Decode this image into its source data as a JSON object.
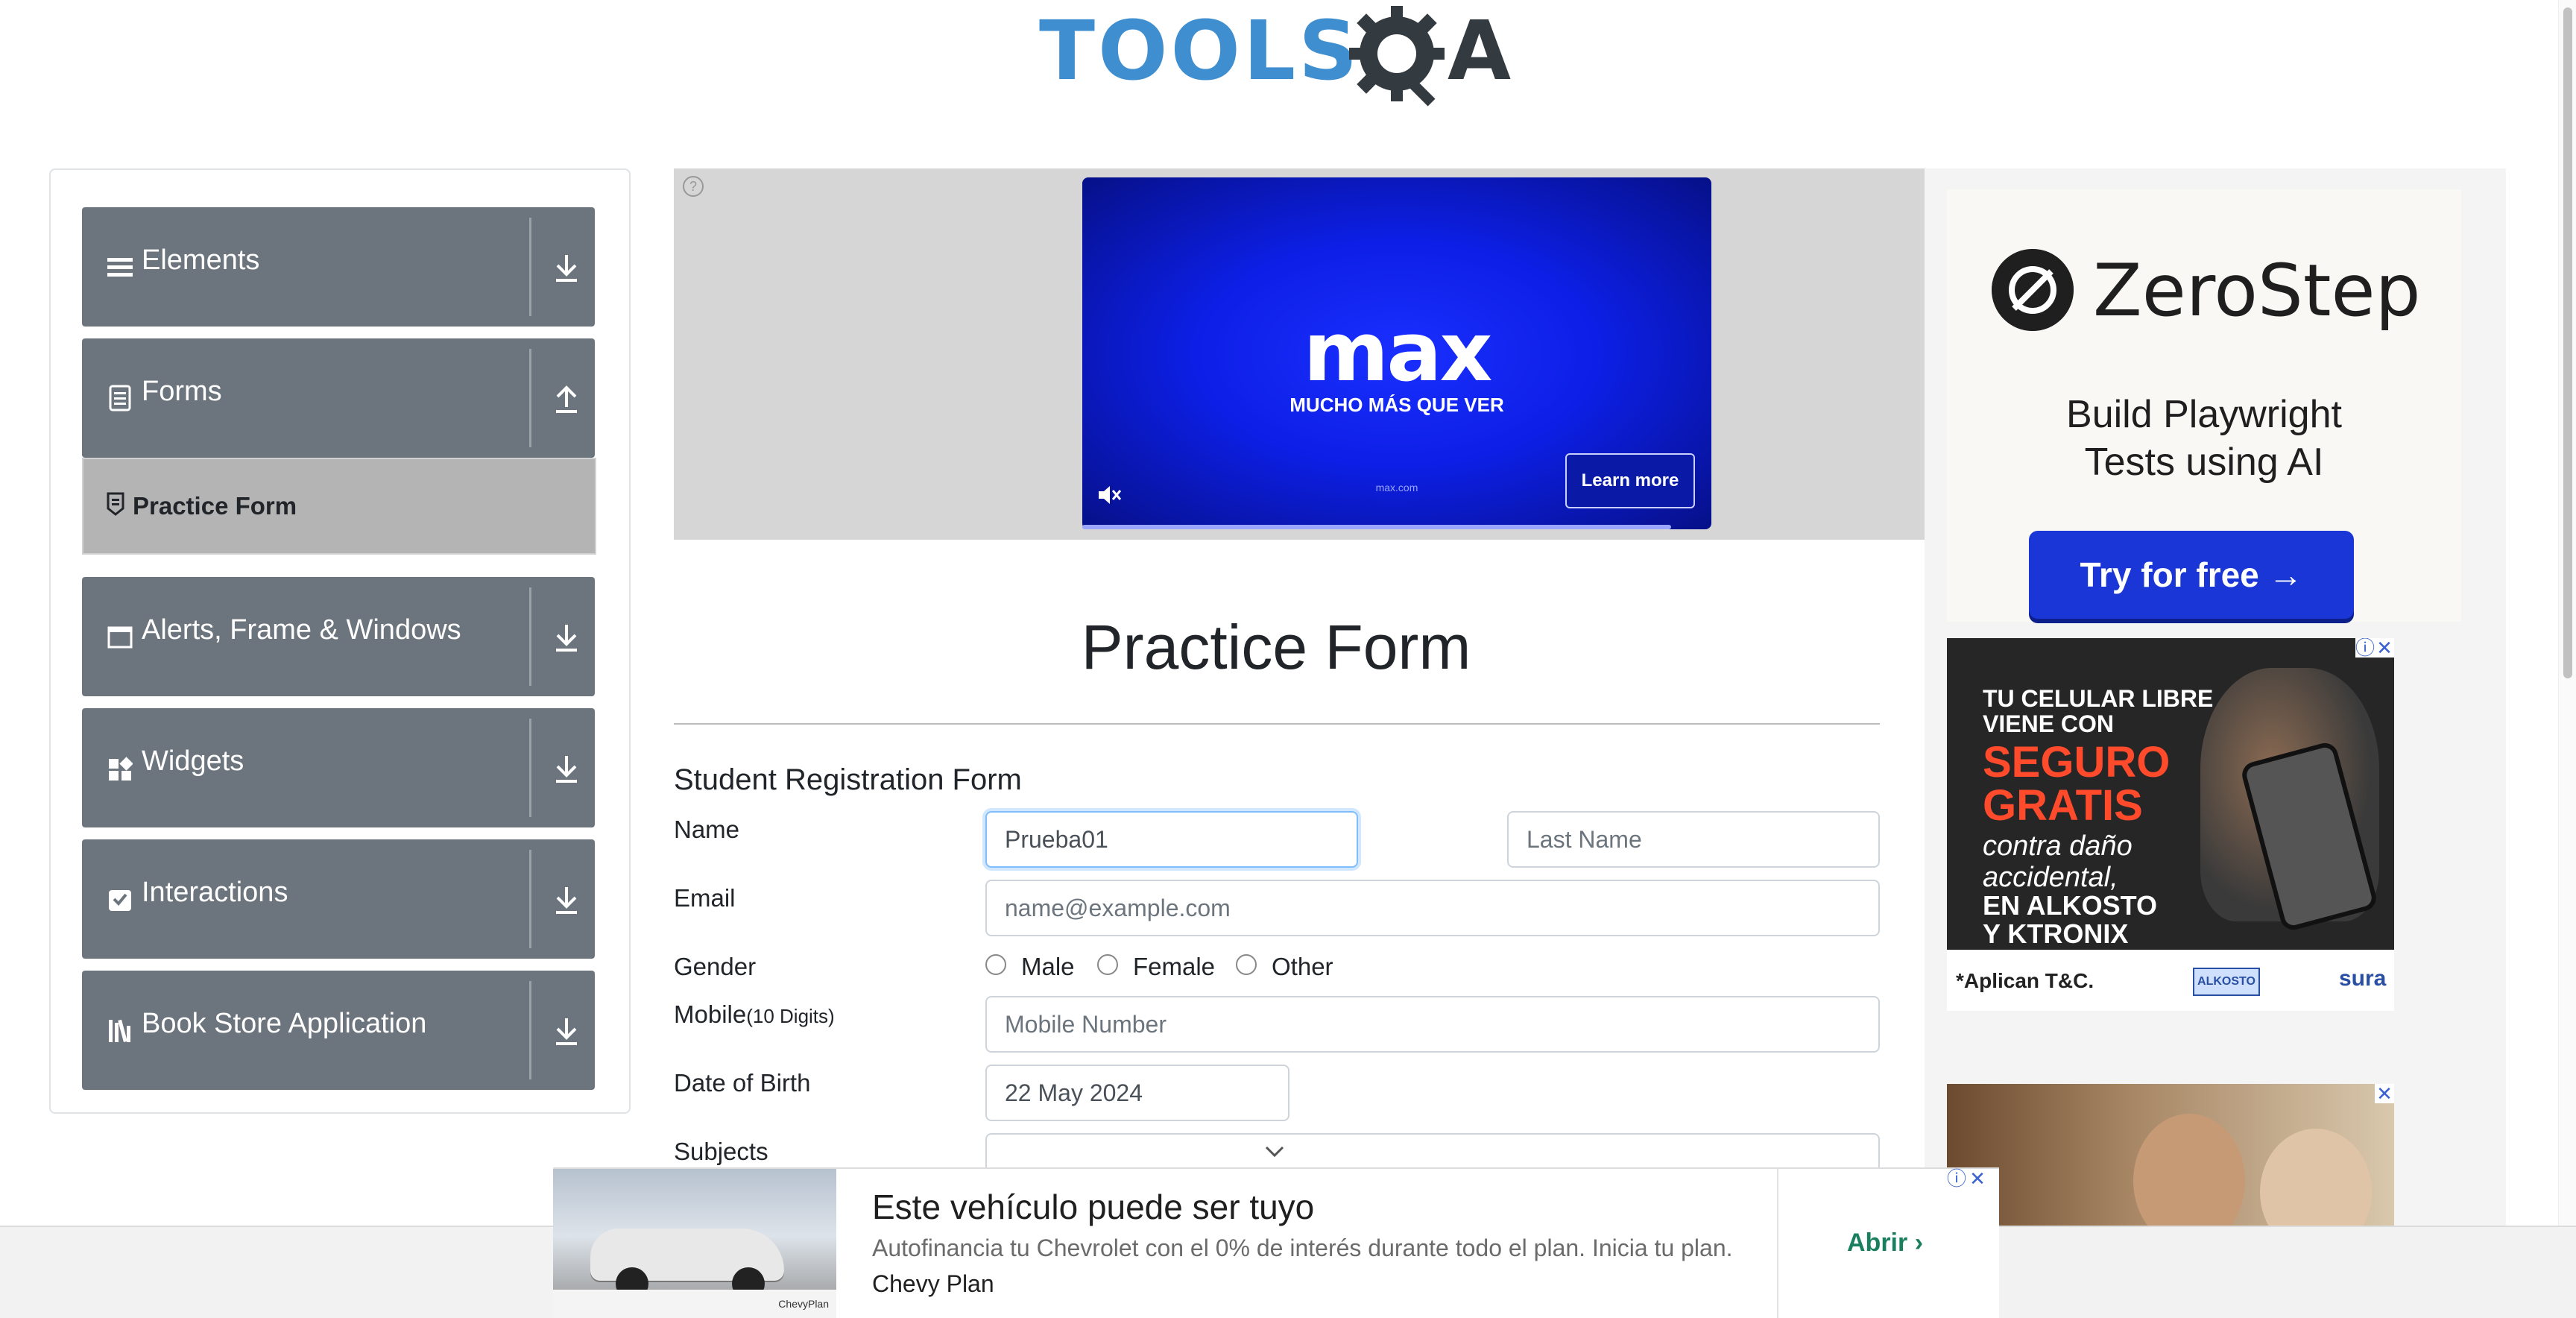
{
  "header": {
    "logo_text": "TOOLS",
    "logo_suffix": "A"
  },
  "sidebar": {
    "groups": [
      {
        "label": "Elements",
        "icon": "hamburger-icon",
        "state": "collapsed"
      },
      {
        "label": "Forms",
        "icon": "document-icon",
        "state": "expanded"
      },
      {
        "label": "Alerts, Frame & Windows",
        "icon": "window-icon",
        "state": "collapsed"
      },
      {
        "label": "Widgets",
        "icon": "widgets-icon",
        "state": "collapsed"
      },
      {
        "label": "Interactions",
        "icon": "interactions-icon",
        "state": "collapsed"
      },
      {
        "label": "Book Store Application",
        "icon": "bookstore-icon",
        "state": "collapsed"
      }
    ],
    "active_item": "Practice Form"
  },
  "top_ad": {
    "brand": "max",
    "tagline": "MUCHO MÁS QUE VER",
    "url": "max.com",
    "cta": "Learn more"
  },
  "form": {
    "page_title": "Practice Form",
    "subtitle": "Student Registration Form",
    "name_label": "Name",
    "first_name_value": "Prueba01",
    "last_name_placeholder": "Last Name",
    "email_label": "Email",
    "email_placeholder": "name@example.com",
    "gender_label": "Gender",
    "gender_options": [
      "Male",
      "Female",
      "Other"
    ],
    "mobile_label": "Mobile",
    "mobile_hint": "(10 Digits)",
    "mobile_placeholder": "Mobile Number",
    "dob_label": "Date of Birth",
    "dob_value": "22 May 2024",
    "subjects_label": "Subjects"
  },
  "right_ads": {
    "zerostep": {
      "name": "ZeroStep",
      "tagline_1": "Build Playwright",
      "tagline_2": "Tests using AI",
      "cta": "Try for free →"
    },
    "phone_ad": {
      "line1": "TU CELULAR LIBRE",
      "line1b": "VIENE CON",
      "line2": "SEGURO",
      "line2b": "GRATIS",
      "line3": "contra daño",
      "line3b": "accidental,",
      "line4": "EN ALKOSTO",
      "line4b": "Y KTRONIX",
      "footer": "*Aplican T&C.",
      "brand_1": "ALKOSTO",
      "brand_2": "sura"
    }
  },
  "bottom_banner": {
    "headline": "Este vehículo puede ser tuyo",
    "description": "Autofinancia tu Chevrolet con el 0% de interés durante todo el plan. Inicia tu plan.",
    "sponsor": "Chevy Plan",
    "cta": "Abrir",
    "image_caption": "ChevyPlan"
  },
  "colors": {
    "sidebar_group": "#6c757d",
    "active_item": "#b4b4b4",
    "logo_blue": "#3e8ed0",
    "cta_blue": "#1a36d6",
    "banner_cta": "#1a7f5e"
  }
}
